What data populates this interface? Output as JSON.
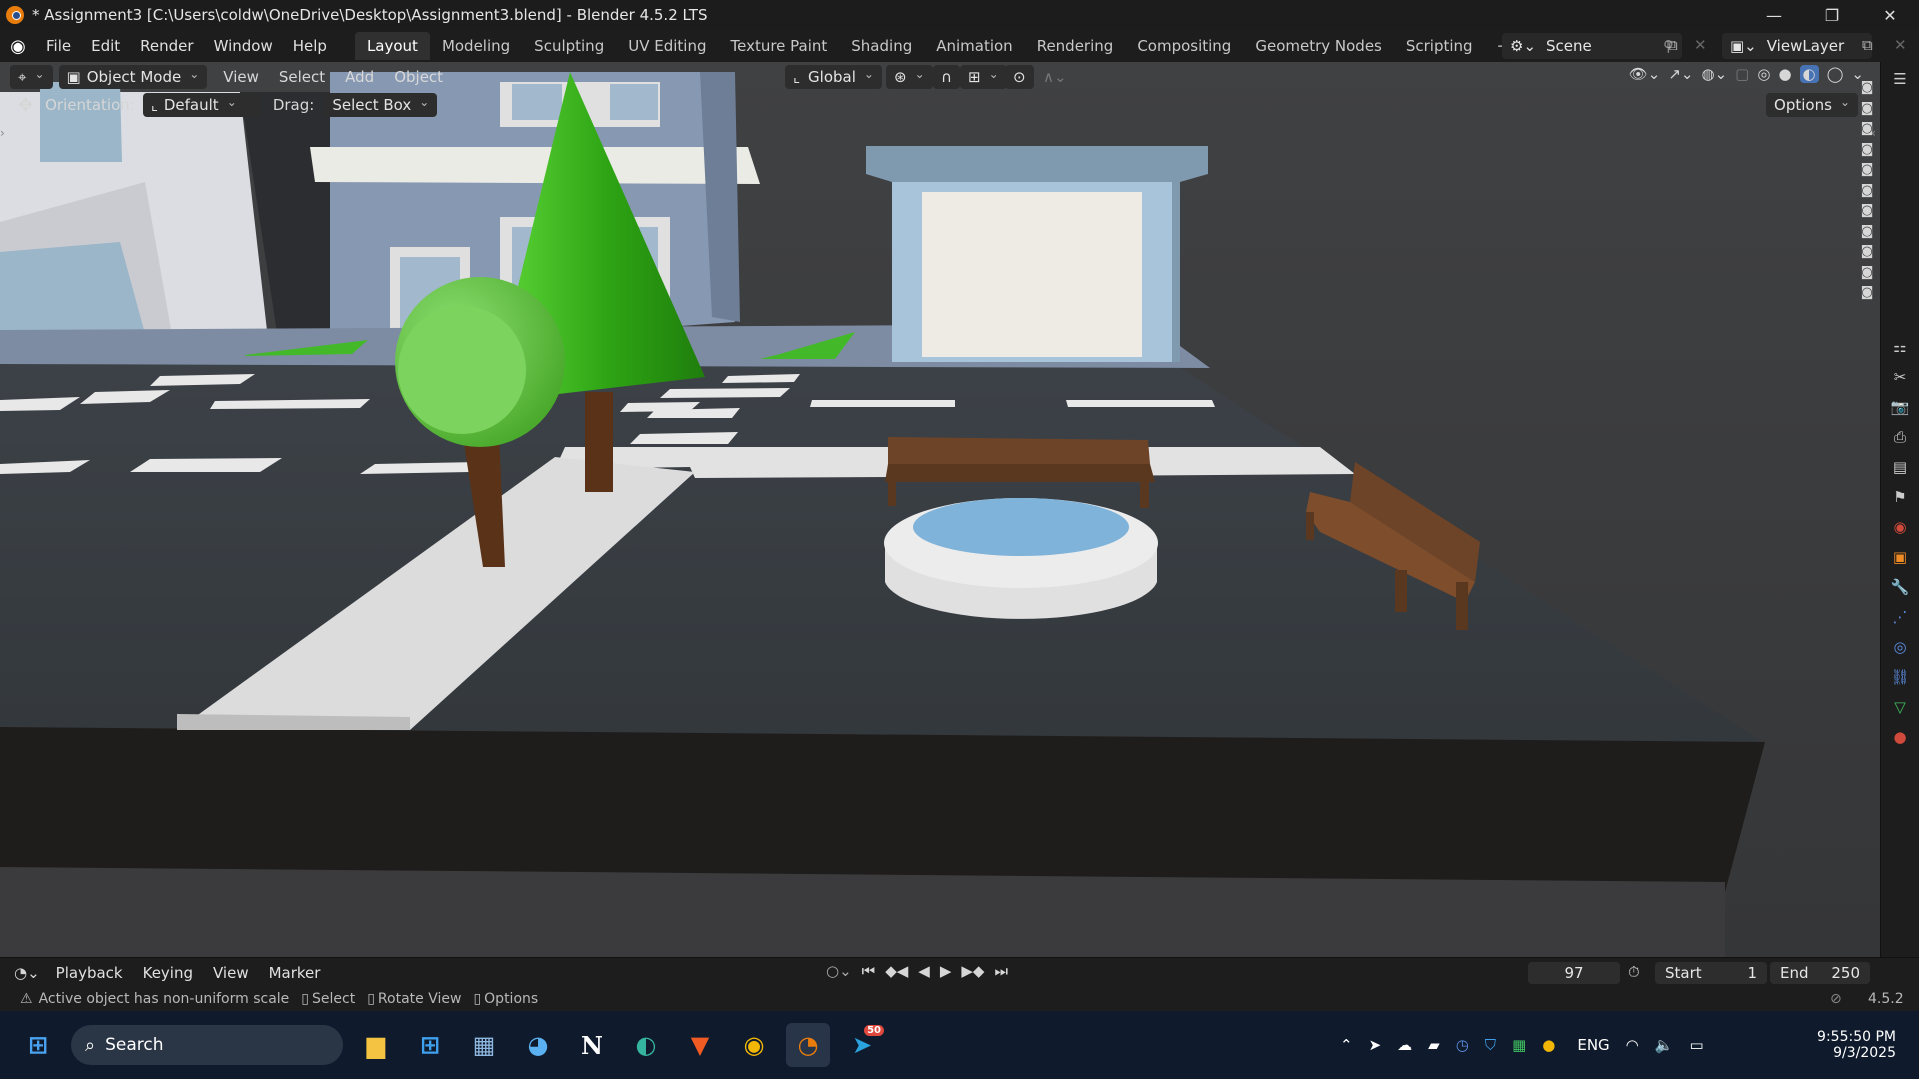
{
  "window": {
    "title": "* Assignment3 [C:\\Users\\coldw\\OneDrive\\Desktop\\Assignment3.blend] - Blender 4.5.2 LTS",
    "minimize": "—",
    "maximize": "❐",
    "close": "✕"
  },
  "menu": [
    "File",
    "Edit",
    "Render",
    "Window",
    "Help"
  ],
  "workspaces": [
    "Layout",
    "Modeling",
    "Sculpting",
    "UV Editing",
    "Texture Paint",
    "Shading",
    "Animation",
    "Rendering",
    "Compositing",
    "Geometry Nodes",
    "Scripting"
  ],
  "active_workspace": "Layout",
  "scene_name": "Scene",
  "view_layer": "ViewLayer",
  "viewport_header": {
    "mode": "Object Mode",
    "menus": [
      "View",
      "Select",
      "Add",
      "Object"
    ],
    "transform_orientation": "Global",
    "options_label": "Options"
  },
  "tool_settings": {
    "orientation_label": "Orientation:",
    "orientation_value": "Default",
    "drag_label": "Drag:",
    "drag_value": "Select Box"
  },
  "timeline": {
    "menus": [
      "Playback",
      "Keying",
      "View",
      "Marker"
    ],
    "current_frame": "97",
    "start_label": "Start",
    "start_value": "1",
    "end_label": "End",
    "end_value": "250"
  },
  "statusbar": {
    "warning": "Active object has non-uniform scale",
    "hints": [
      "Select",
      "Rotate View",
      "Options"
    ],
    "version": "4.5.2"
  },
  "taskbar": {
    "search_placeholder": "Search",
    "language": "ENG",
    "time": "9:55:50 PM",
    "date": "9/3/2025",
    "telegram_badge": "50"
  },
  "colors": {
    "accent": "#4772b3",
    "blender_orange": "#e87d0d",
    "tree_green": "#3dba1e",
    "bench_brown": "#6e4428",
    "pool_water": "#7fb3d9"
  }
}
